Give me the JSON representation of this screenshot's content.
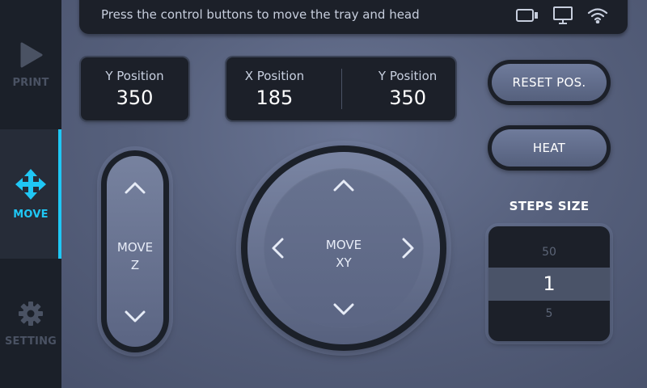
{
  "sidebar": {
    "items": [
      {
        "label": "PRINT",
        "icon": "play-icon",
        "active": false
      },
      {
        "label": "MOVE",
        "icon": "move-arrows-icon",
        "active": true
      },
      {
        "label": "SETTING",
        "icon": "gear-icon",
        "active": false
      }
    ]
  },
  "status_bar": {
    "message": "Press the control buttons to move the tray and head",
    "icons": [
      "card-reader-icon",
      "monitor-icon",
      "wifi-icon"
    ]
  },
  "z_position": {
    "label": "Y Position",
    "value": "350"
  },
  "xy_position": {
    "x": {
      "label": "X Position",
      "value": "185"
    },
    "y": {
      "label": "Y Position",
      "value": "350"
    }
  },
  "buttons": {
    "reset": "RESET POS.",
    "heat": "HEAT"
  },
  "move_z": {
    "line1": "MOVE",
    "line2": "Z"
  },
  "move_xy": {
    "line1": "MOVE",
    "line2": "XY"
  },
  "steps": {
    "title": "STEPS SIZE",
    "above": "50",
    "selected": "1",
    "below": "5"
  },
  "colors": {
    "accent": "#1fc7f5",
    "panel": "#1c2029",
    "sidebar": "#1b2029"
  }
}
